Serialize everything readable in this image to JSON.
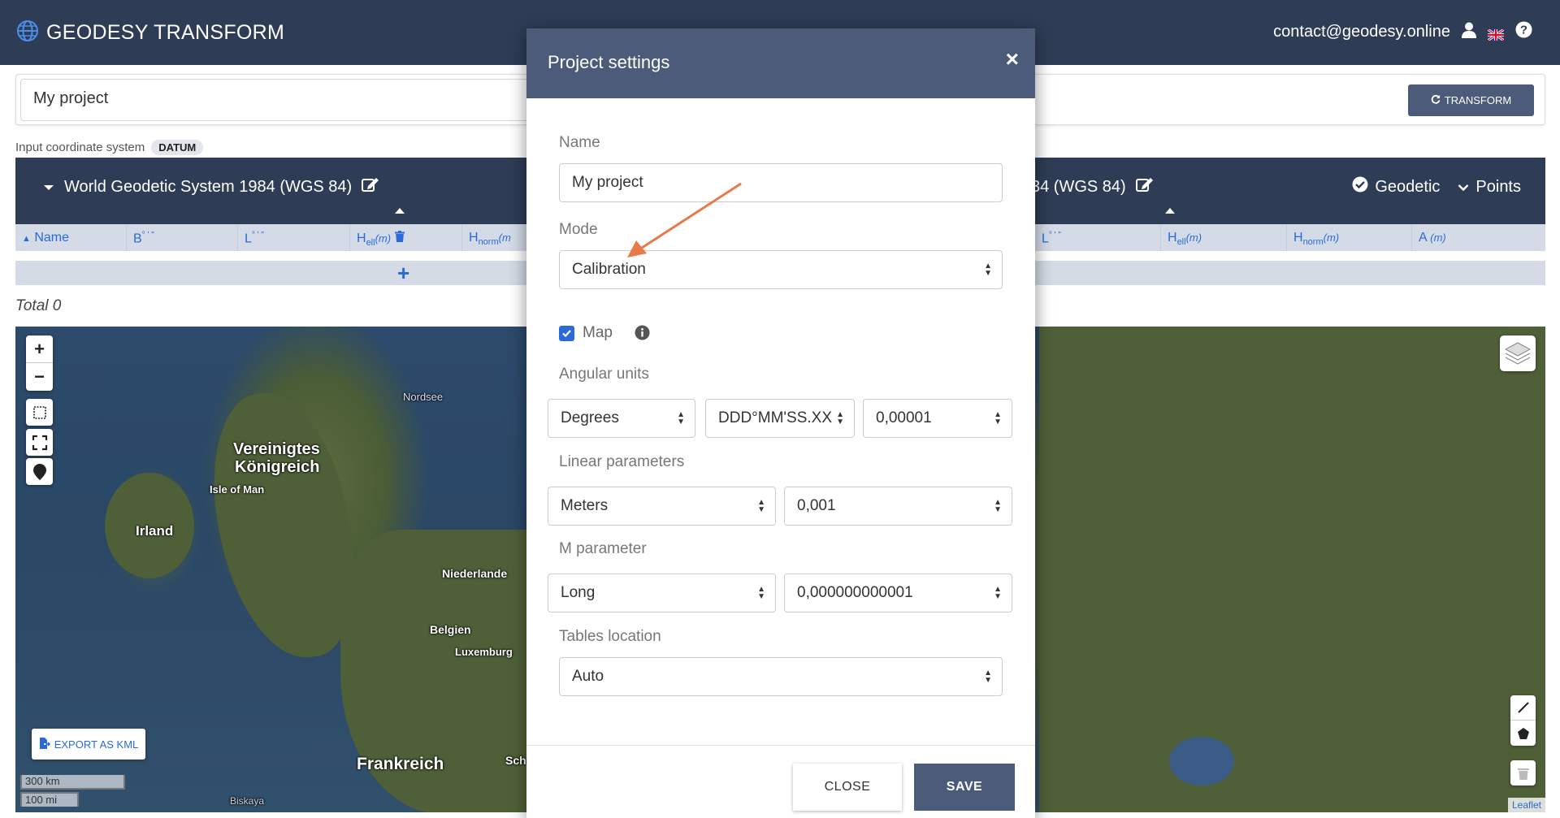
{
  "header": {
    "title": "GEODESY TRANSFORM",
    "email": "contact@geodesy.online"
  },
  "namebar": {
    "project_name": "My project",
    "transform_label": "TRANSFORM"
  },
  "input_cs": {
    "label": "Input coordinate system",
    "badge": "DATUM"
  },
  "cs_panel": {
    "left_name": "World Geodetic System 1984 (WGS 84)",
    "right_name_partial": "34 (WGS 84)",
    "geodetic_label": "Geodetic",
    "points_label": "Points",
    "columns_left": [
      {
        "label": "Name"
      },
      {
        "label": "B",
        "sup": "° ' \""
      },
      {
        "label": "L",
        "sup": "° ' \""
      },
      {
        "label": "H",
        "sub": "ell",
        "unit": "(m)"
      },
      {
        "label": "H",
        "sub": "norm",
        "unit": "(m"
      }
    ],
    "columns_right": [
      {
        "label": "L",
        "sup": "° ' \""
      },
      {
        "label": "H",
        "sub": "ell",
        "unit": "(m)"
      },
      {
        "label": "H",
        "sub": "norm",
        "unit": "(m)"
      },
      {
        "label": "A",
        "unit": "(m)"
      }
    ]
  },
  "total": "Total 0",
  "map": {
    "zoom_in": "+",
    "zoom_out": "−",
    "labels": [
      "Nordsee",
      "Vereinigtes",
      "Königreich",
      "Isle of Man",
      "Irland",
      "Niederlande",
      "Belgien",
      "Luxemburg",
      "Frankreich",
      "Biskaya",
      "Sch"
    ],
    "export_kml": "EXPORT AS KML",
    "scale_km": "300 km",
    "scale_mi": "100 mi",
    "attribution": "Leaflet"
  },
  "modal": {
    "title": "Project settings",
    "name_label": "Name",
    "name_value": "My project",
    "mode_label": "Mode",
    "mode_value": "Calibration",
    "map_checkbox_label": "Map",
    "map_checked": true,
    "angular_label": "Angular units",
    "angular_unit": "Degrees",
    "angular_format": "DDD°MM'SS.XX",
    "angular_precision": "0,00001",
    "linear_label": "Linear parameters",
    "linear_unit": "Meters",
    "linear_precision": "0,001",
    "m_label": "M parameter",
    "m_unit": "Long",
    "m_precision": "0,000000000001",
    "tables_label": "Tables location",
    "tables_value": "Auto",
    "close_label": "CLOSE",
    "save_label": "SAVE"
  },
  "colors": {
    "header_bg": "#2e3d55",
    "modal_header_bg": "#4b5b79",
    "accent_blue": "#2a6ad8",
    "arrow": "#e8794a"
  }
}
